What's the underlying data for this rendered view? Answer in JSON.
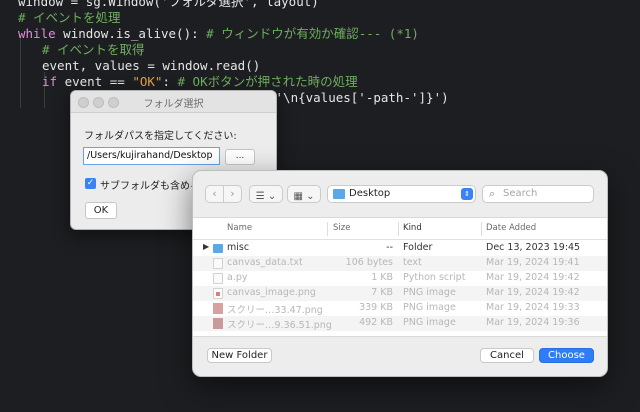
{
  "editor": {
    "line1": "window = sg.Window('フォルダ選択', layout)",
    "line2_comment": "# イベントを処理",
    "line3_kw": "while",
    "line3_code": " window.is_alive(): ",
    "line3_comment": "# ウィンドウが有効か確認--- (*1)",
    "line4_comment": "# イベントを取得",
    "line5_code": "event, values = window.read()",
    "line6_kw": "if",
    "line6_code": " event == ",
    "line6_str": "\"OK\"",
    "line6_colon": ": ",
    "line6_comment": "# OKボタンが押された時の処理",
    "line7_tail": "f'\\n{values['-path-']}')"
  },
  "folder_dialog": {
    "title": "フォルダ選択",
    "prompt": "フォルダパスを指定してください:",
    "path_value": "/Users/kujirahand/Desktop",
    "browse_label": "...",
    "checkbox_label": "サブフォルダも含める",
    "checkbox_checked": true,
    "ok_label": "OK"
  },
  "open_panel": {
    "nav_back": "‹",
    "nav_forward": "›",
    "view_list": "☰ ⌄",
    "view_grid": "▦ ⌄",
    "location": "Desktop",
    "search_placeholder": "Search",
    "columns": [
      "Name",
      "Size",
      "Kind",
      "Date Added"
    ],
    "rows": [
      {
        "name": "misc",
        "size": "--",
        "kind": "Folder",
        "date": "Dec 13, 2023 19:45",
        "type": "folder"
      },
      {
        "name": "canvas_data.txt",
        "size": "106 bytes",
        "kind": "text",
        "date": "Mar 19, 2024 19:41",
        "type": "text"
      },
      {
        "name": "a.py",
        "size": "1 KB",
        "kind": "Python script",
        "date": "Mar 19, 2024 19:42",
        "type": "py"
      },
      {
        "name": "canvas_image.png",
        "size": "7 KB",
        "kind": "PNG image",
        "date": "Mar 19, 2024 19:42",
        "type": "png"
      },
      {
        "name": "スクリー…33.47.png",
        "size": "339 KB",
        "kind": "PNG image",
        "date": "Mar 19, 2024 19:33",
        "type": "png"
      },
      {
        "name": "スクリー…9.36.51.png",
        "size": "492 KB",
        "kind": "PNG image",
        "date": "Mar 19, 2024 19:36",
        "type": "png"
      }
    ],
    "new_folder_label": "New Folder",
    "cancel_label": "Cancel",
    "choose_label": "Choose",
    "accent_color": "#2f7df6",
    "folder_color": "#5aa8e6"
  }
}
